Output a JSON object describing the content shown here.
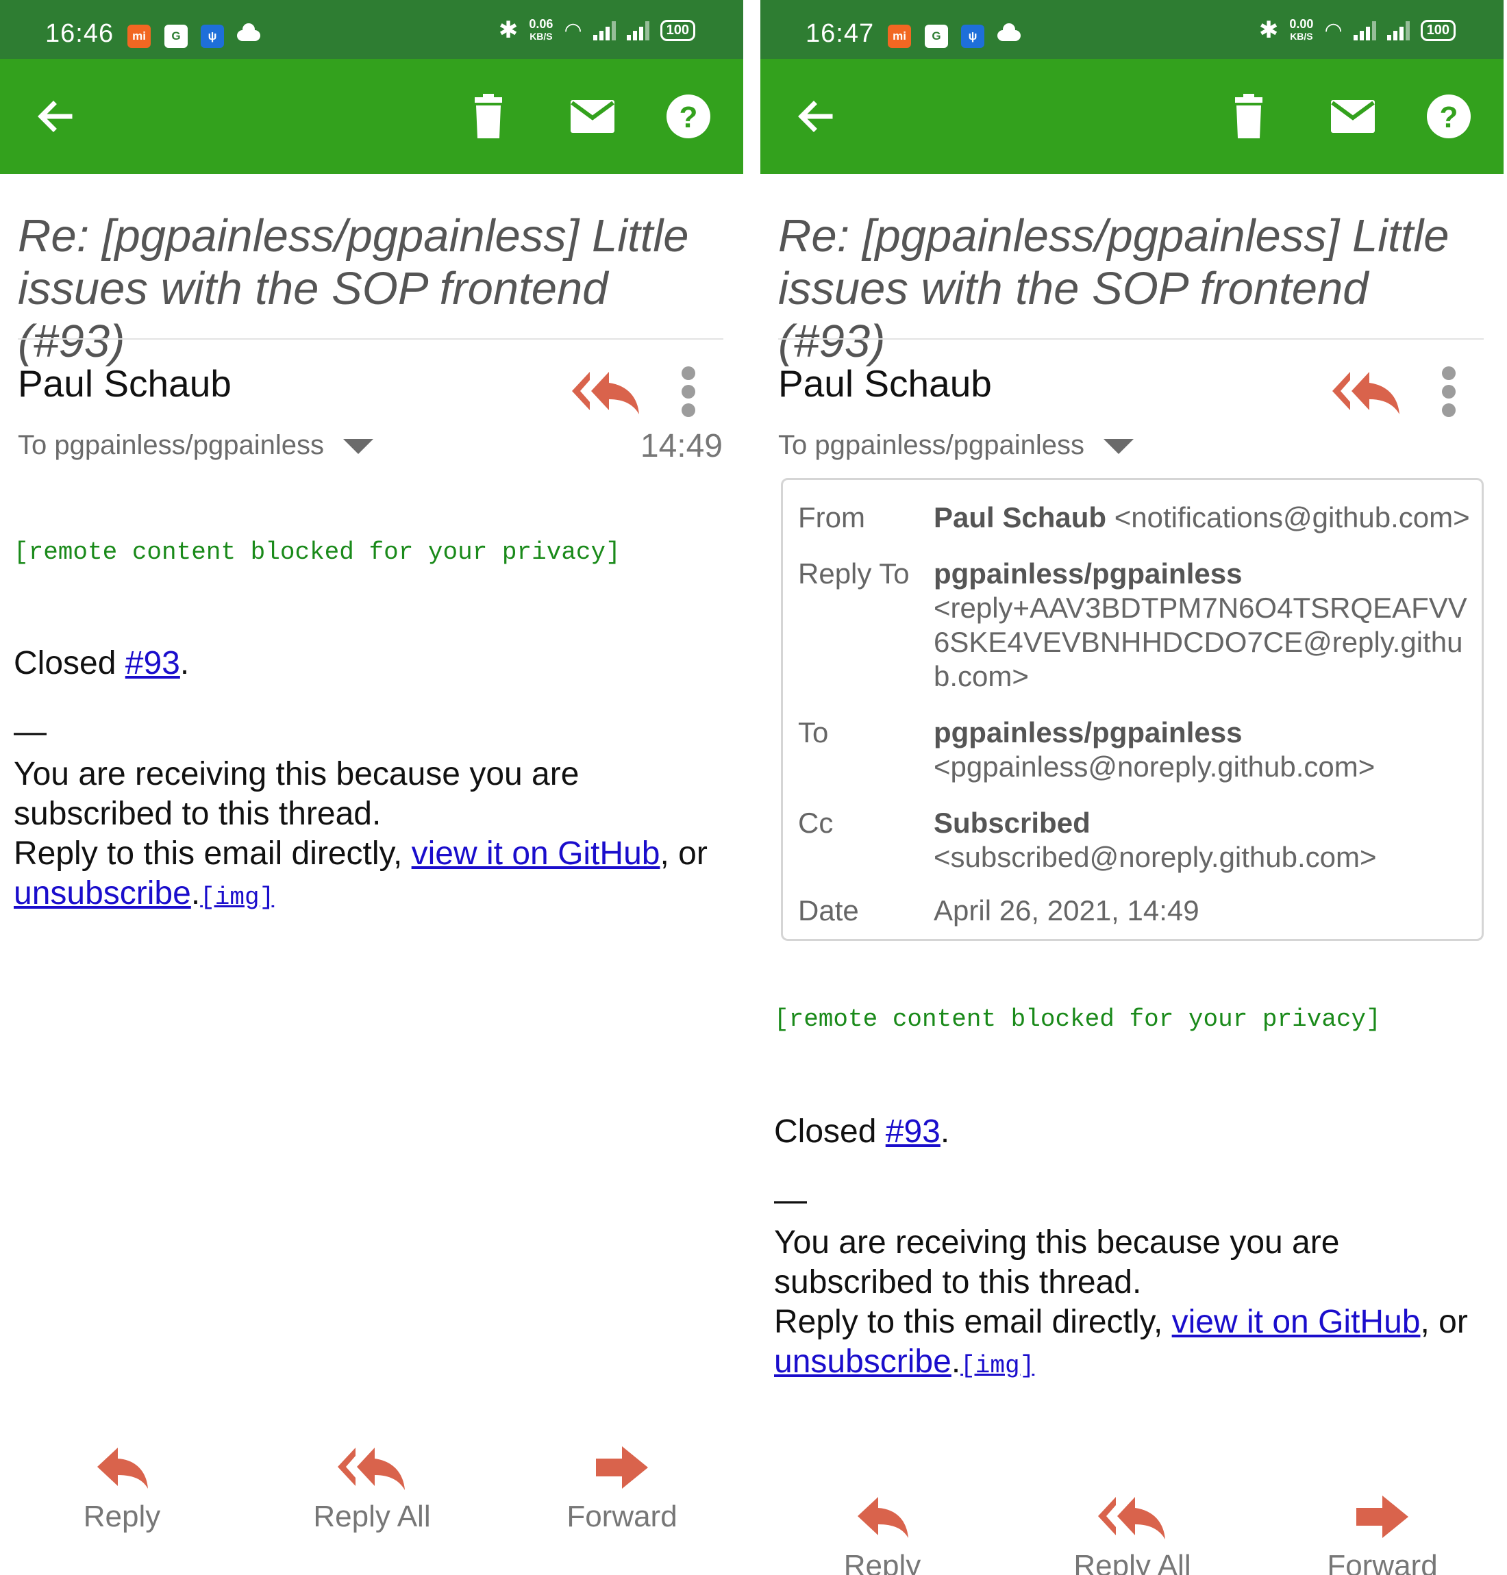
{
  "left": {
    "status": {
      "time": "16:46",
      "speed": "0.06",
      "speed_unit": "KB/S",
      "battery": "100"
    },
    "subject": "Re: [pgpainless/pgpainless] Little issues with the SOP frontend (#93)",
    "sender": "Paul Schaub",
    "to": "To pgpainless/pgpainless",
    "time": "14:49",
    "blocked": "[remote content blocked for your privacy]",
    "closed_prefix": "Closed ",
    "closed_link": "#93",
    "closed_suffix": ".",
    "dash": "—",
    "receiving": "You are receiving this because you are subscribed to this thread.",
    "reply_prefix": "Reply to this email directly, ",
    "view_link": "view it on GitHub",
    "reply_or": ", or",
    "unsubscribe": "unsubscribe",
    "period": ".",
    "img": "[img]",
    "actions": {
      "reply": "Reply",
      "reply_all": "Reply All",
      "forward": "Forward"
    }
  },
  "right": {
    "status": {
      "time": "16:47",
      "speed": "0.00",
      "speed_unit": "KB/S",
      "battery": "100"
    },
    "subject": "Re: [pgpainless/pgpainless] Little issues with the SOP frontend (#93)",
    "sender": "Paul Schaub",
    "to": "To pgpainless/pgpainless",
    "details": {
      "from_label": "From",
      "from_name": "Paul Schaub",
      "from_email": " <notifications@github.com>",
      "replyto_label": "Reply To",
      "replyto_name": "pgpainless/pgpainless",
      "replyto_email": "<reply+AAV3BDTPM7N6O4TSRQEAFVV6SKE4VEVBNHHDCDO7CE@reply.github.com>",
      "to_label": "To",
      "to_name": "pgpainless/pgpainless",
      "to_email": "<pgpainless@noreply.github.com>",
      "cc_label": "Cc",
      "cc_name": "Subscribed",
      "cc_email": " <subscribed@noreply.github.com>",
      "date_label": "Date",
      "date_value": "April 26, 2021, 14:49"
    },
    "blocked": "[remote content blocked for your privacy]",
    "closed_prefix": "Closed ",
    "closed_link": "#93",
    "closed_suffix": ".",
    "dash": "—",
    "receiving": "You are receiving this because you are subscribed to this thread.",
    "reply_prefix": "Reply to this email directly, ",
    "view_link": "view it on GitHub",
    "reply_or": ", or",
    "unsubscribe": "unsubscribe",
    "period": ".",
    "img": "[img]",
    "actions": {
      "reply": "Reply",
      "reply_all": "Reply All",
      "forward": "Forward"
    }
  },
  "colors": {
    "statusbar": "#2e7d32",
    "appbar": "#33a11d",
    "accent_icon": "#d9634c",
    "link": "#1a0dcc",
    "blocked_text": "#1a8a1a"
  },
  "icons": [
    "back-arrow-icon",
    "trash-icon",
    "mail-icon",
    "help-icon",
    "reply-all-icon",
    "more-vert-icon",
    "reply-icon",
    "forward-icon"
  ]
}
